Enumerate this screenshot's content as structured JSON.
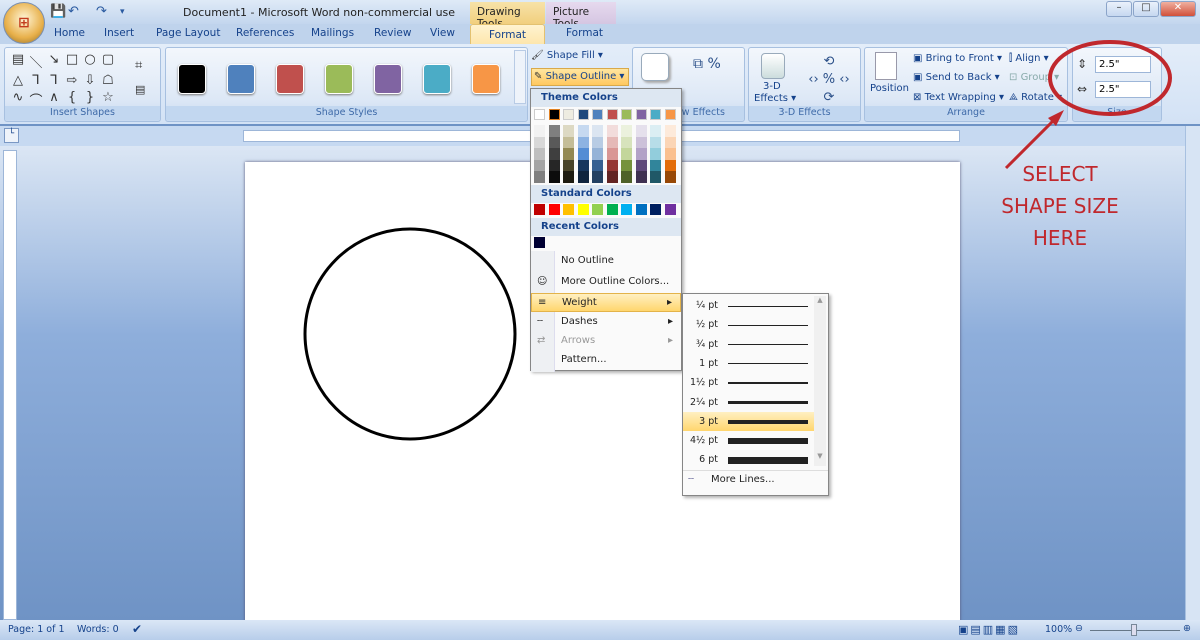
{
  "window": {
    "title": "Document1 - Microsoft Word non-commercial use",
    "context_tabs": [
      "Drawing Tools",
      "Picture Tools"
    ],
    "controls": [
      "–",
      "□",
      "✕"
    ]
  },
  "qat": {
    "save": "💾",
    "undo": "↶",
    "redo": "↷",
    "customize": "▾"
  },
  "tabs": [
    "Home",
    "Insert",
    "Page Layout",
    "References",
    "Mailings",
    "Review",
    "View",
    "Format",
    "Format"
  ],
  "ribbon": {
    "insert_shapes": {
      "label": "Insert Shapes",
      "shapes": [
        "▤",
        "＼",
        "↘",
        "□",
        "○",
        "▢",
        "△",
        "⅂",
        "⅂",
        "⇨",
        "⇩",
        "☖",
        "∿",
        "⌒",
        "∧",
        "{",
        "}",
        "☆"
      ]
    },
    "shape_styles": {
      "label": "Shape Styles",
      "swatches": [
        "#000000",
        "#4f81bd",
        "#c0504d",
        "#9bbb59",
        "#8064a2",
        "#4bacc6",
        "#f79646"
      ]
    },
    "shape_fill": "Shape Fill ▾",
    "shape_outline": "Shape Outline ▾",
    "shadow": {
      "label": "Shadow",
      "group": "Shadow Effects"
    },
    "three_d": {
      "label": "3-D",
      "label2": "Effects ▾",
      "group": "3-D Effects"
    },
    "arrange": {
      "label": "Arrange",
      "position": "Position",
      "bring_to_front": "Bring to Front ▾",
      "send_to_back": "Send to Back ▾",
      "text_wrapping": "Text Wrapping ▾",
      "align": "Align ▾",
      "group": "Group ▾",
      "rotate": "Rotate ▾"
    },
    "size": {
      "label": "Size",
      "height": "2.5\"",
      "width": "2.5\""
    }
  },
  "outline_menu": {
    "theme_colors_label": "Theme Colors",
    "theme_top": [
      "#ffffff",
      "#000000",
      "#eeece1",
      "#1f497d",
      "#4f81bd",
      "#c0504d",
      "#9bbb59",
      "#8064a2",
      "#4bacc6",
      "#f79646"
    ],
    "theme_shades": [
      [
        "#f2f2f2",
        "#d8d8d8",
        "#bfbfbf",
        "#a5a5a5",
        "#7f7f7f"
      ],
      [
        "#7f7f7f",
        "#595959",
        "#3f3f3f",
        "#262626",
        "#0c0c0c"
      ],
      [
        "#ddd9c3",
        "#c4bd97",
        "#938953",
        "#494429",
        "#1d1b10"
      ],
      [
        "#c6d9f0",
        "#8db3e2",
        "#548dd4",
        "#17365d",
        "#0f243e"
      ],
      [
        "#dbe5f1",
        "#b8cce4",
        "#95b3d7",
        "#366092",
        "#244061"
      ],
      [
        "#f2dcdb",
        "#e5b9b7",
        "#d99694",
        "#953734",
        "#632423"
      ],
      [
        "#ebf1dd",
        "#d7e3bc",
        "#c3d69b",
        "#76923c",
        "#4f6128"
      ],
      [
        "#e5e0ec",
        "#ccc1d9",
        "#b2a2c7",
        "#5f497a",
        "#3f3151"
      ],
      [
        "#dbeef3",
        "#b7dde8",
        "#92cddc",
        "#31859b",
        "#205867"
      ],
      [
        "#fdeada",
        "#fbd5b5",
        "#fac08f",
        "#e36c09",
        "#974806"
      ]
    ],
    "standard_colors_label": "Standard Colors",
    "standard": [
      "#c00000",
      "#ff0000",
      "#ffc000",
      "#ffff00",
      "#92d050",
      "#00b050",
      "#00b0f0",
      "#0070c0",
      "#002060",
      "#7030a0"
    ],
    "recent_colors_label": "Recent Colors",
    "recent": [
      "#000033"
    ],
    "items": [
      "No Outline",
      "More Outline Colors...",
      "Weight",
      "Dashes",
      "Arrows",
      "Pattern..."
    ]
  },
  "weight_menu": {
    "items": [
      {
        "label": "¼ pt",
        "w": 0.25
      },
      {
        "label": "½ pt",
        "w": 0.5
      },
      {
        "label": "¾ pt",
        "w": 0.75
      },
      {
        "label": "1 pt",
        "w": 1
      },
      {
        "label": "1½ pt",
        "w": 1.5
      },
      {
        "label": "2¼ pt",
        "w": 2.25
      },
      {
        "label": "3 pt",
        "w": 3,
        "selected": true
      },
      {
        "label": "4½ pt",
        "w": 4.5
      },
      {
        "label": "6 pt",
        "w": 6
      }
    ],
    "more_lines": "More Lines..."
  },
  "annotation": {
    "lines": [
      "SELECT",
      "SHAPE SIZE",
      "HERE"
    ],
    "color": "#c0282d"
  },
  "status": {
    "page": "Page: 1 of 1",
    "words": "Words: 0",
    "zoom": "100%"
  }
}
